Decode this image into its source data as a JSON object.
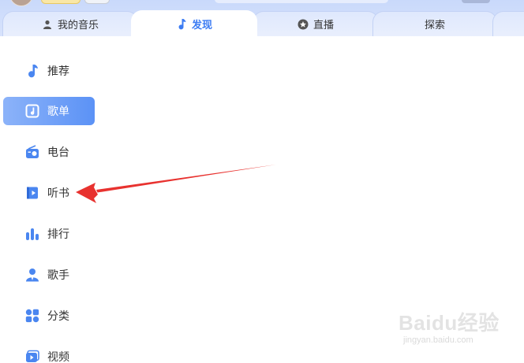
{
  "header": {
    "tabs": [
      {
        "label": "我的音乐",
        "icon": "user-icon",
        "active": false
      },
      {
        "label": "发现",
        "icon": "music-note-icon",
        "active": true
      },
      {
        "label": "直播",
        "icon": "star-circle-icon",
        "active": false
      },
      {
        "label": "探索",
        "icon": "",
        "active": false
      }
    ]
  },
  "sidebar": {
    "items": [
      {
        "label": "推荐",
        "icon": "music-note-icon",
        "active": false
      },
      {
        "label": "歌单",
        "icon": "playlist-icon",
        "active": true
      },
      {
        "label": "电台",
        "icon": "radio-icon",
        "active": false
      },
      {
        "label": "听书",
        "icon": "book-icon",
        "active": false
      },
      {
        "label": "排行",
        "icon": "chart-bars-icon",
        "active": false
      },
      {
        "label": "歌手",
        "icon": "singer-icon",
        "active": false
      },
      {
        "label": "分类",
        "icon": "category-icon",
        "active": false
      },
      {
        "label": "视频",
        "icon": "video-icon",
        "active": false
      }
    ]
  },
  "annotation": {
    "color": "#e8322f",
    "target": "听书"
  },
  "watermark": {
    "text": "Baidu经验",
    "subtext": "jingyan.baidu.com"
  },
  "colors": {
    "accent": "#3c7cf3",
    "icon": "#4a86f0",
    "active_bg_start": "#8cb3f9",
    "active_bg_end": "#5b92f6"
  }
}
